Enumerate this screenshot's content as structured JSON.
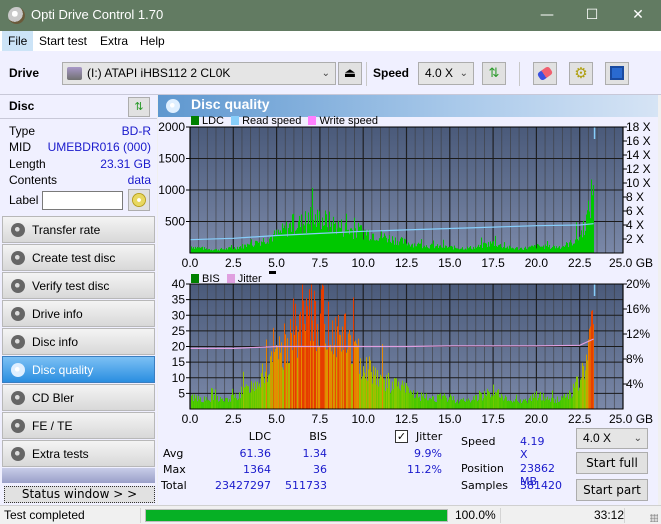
{
  "window": {
    "title": "Opti Drive Control 1.70",
    "minimize": "—",
    "maximize": "☐",
    "close": "✕"
  },
  "menu": [
    {
      "label": "File"
    },
    {
      "label": "Start test"
    },
    {
      "label": "Extra"
    },
    {
      "label": "Help"
    }
  ],
  "toolbar": {
    "drive_label": "Drive",
    "drive_value": "(I:)  ATAPI iHBS112   2 CL0K",
    "speed_label": "Speed",
    "speed_value": "4.0 X"
  },
  "disc": {
    "title": "Disc",
    "rows": [
      {
        "key": "Type",
        "value": "BD-R"
      },
      {
        "key": "MID",
        "value": "UMEBDR016 (000)"
      },
      {
        "key": "Length",
        "value": "23.31 GB"
      },
      {
        "key": "Contents",
        "value": "data"
      }
    ],
    "label_key": "Label",
    "label_value": ""
  },
  "nav": [
    {
      "label": "Transfer rate",
      "active": false
    },
    {
      "label": "Create test disc",
      "active": false
    },
    {
      "label": "Verify test disc",
      "active": false
    },
    {
      "label": "Drive info",
      "active": false
    },
    {
      "label": "Disc info",
      "active": false
    },
    {
      "label": "Disc quality",
      "active": true
    },
    {
      "label": "CD Bler",
      "active": false
    },
    {
      "label": "FE / TE",
      "active": false
    },
    {
      "label": "Extra tests",
      "active": false
    }
  ],
  "status_window_btn": "Status window > >",
  "panel": {
    "title": "Disc quality",
    "legend1": [
      "LDC",
      "Read speed",
      "Write speed"
    ],
    "legend2": [
      "BIS",
      "Jitter"
    ]
  },
  "colors": {
    "ldc": "#008000",
    "read_speed": "#87cefa",
    "write_speed": "#ff80ff",
    "bis": "#008000",
    "jitter": "#e0a0e0",
    "plot_bg_top": "#4a5a7a",
    "plot_bg_bottom": "#7a88a8",
    "accent": "#1a1acc",
    "progress": "#06b025"
  },
  "chart_data": [
    {
      "type": "area",
      "title": "LDC / Read speed",
      "xlabel": "GB",
      "xlim": [
        0,
        25
      ],
      "x_ticks": [
        "0.0",
        "2.5",
        "5.0",
        "7.5",
        "10.0",
        "12.5",
        "15.0",
        "17.5",
        "20.0",
        "22.5",
        "25.0 GB"
      ],
      "ylim_left": [
        0,
        2000
      ],
      "y_ticks_left": [
        "500",
        "1000",
        "1500",
        "2000"
      ],
      "ylim_right": [
        0,
        18
      ],
      "y_ticks_right": [
        "2 X",
        "4 X",
        "6 X",
        "8 X",
        "10 X",
        "12 X",
        "14 X",
        "16 X",
        "18 X"
      ],
      "grid": true,
      "series": [
        {
          "name": "LDC",
          "x": [
            0,
            0.5,
            1,
            1.5,
            2,
            2.5,
            3,
            3.5,
            4,
            4.5,
            5,
            5.5,
            6,
            6.5,
            7,
            7.5,
            8,
            8.5,
            9,
            9.5,
            10,
            10.5,
            11,
            11.5,
            12,
            12.5,
            13,
            13.5,
            14,
            14.5,
            15,
            15.5,
            16,
            16.5,
            17,
            17.5,
            18,
            18.5,
            19,
            19.5,
            20,
            20.5,
            21,
            21.5,
            22,
            22.5,
            23,
            23.3
          ],
          "values": [
            120,
            90,
            70,
            60,
            70,
            90,
            120,
            150,
            200,
            260,
            320,
            420,
            520,
            520,
            560,
            600,
            540,
            480,
            420,
            400,
            380,
            340,
            300,
            260,
            220,
            180,
            150,
            130,
            120,
            110,
            100,
            90,
            90,
            100,
            140,
            180,
            120,
            90,
            80,
            90,
            120,
            110,
            100,
            120,
            180,
            300,
            700,
            1300
          ]
        },
        {
          "name": "Read speed",
          "x": [
            0,
            2.5,
            5,
            7.5,
            10,
            12.5,
            15,
            17.5,
            20,
            22.5,
            23.3
          ],
          "values": [
            1.9,
            2.1,
            2.5,
            2.8,
            3.1,
            3.3,
            3.5,
            3.7,
            3.9,
            4.0,
            4.19
          ]
        }
      ]
    },
    {
      "type": "bar",
      "title": "BIS / Jitter",
      "xlabel": "GB",
      "xlim": [
        0,
        25
      ],
      "x_ticks": [
        "0.0",
        "2.5",
        "5.0",
        "7.5",
        "10.0",
        "12.5",
        "15.0",
        "17.5",
        "20.0",
        "22.5",
        "25.0 GB"
      ],
      "ylim_left": [
        0,
        40
      ],
      "y_ticks_left": [
        "5",
        "10",
        "15",
        "20",
        "25",
        "30",
        "35",
        "40"
      ],
      "ylim_right": [
        0,
        20
      ],
      "y_ticks_right": [
        "4%",
        "8%",
        "12%",
        "16%",
        "20%"
      ],
      "grid": true,
      "series": [
        {
          "name": "BIS",
          "x": [
            0,
            0.5,
            1,
            1.5,
            2,
            2.5,
            3,
            3.5,
            4,
            4.5,
            5,
            5.5,
            6,
            6.5,
            7,
            7.5,
            8,
            8.5,
            9,
            9.5,
            10,
            10.5,
            11,
            11.5,
            12,
            12.5,
            13,
            13.5,
            14,
            14.5,
            15,
            15.5,
            16,
            16.5,
            17,
            17.5,
            18,
            18.5,
            19,
            19.5,
            20,
            20.5,
            21,
            21.5,
            22,
            22.5,
            23,
            23.3
          ],
          "values": [
            4,
            4,
            3,
            4,
            3,
            4,
            6,
            8,
            11,
            14,
            17,
            23,
            29,
            28,
            32,
            33,
            29,
            27,
            25,
            20,
            16,
            14,
            11,
            9,
            8,
            7,
            5,
            4,
            4,
            4,
            4,
            3,
            3,
            4,
            5,
            7,
            4,
            3,
            3,
            3,
            5,
            4,
            3,
            4,
            6,
            10,
            20,
            36
          ]
        },
        {
          "name": "Jitter",
          "x": [
            0,
            2.5,
            5,
            7.5,
            10,
            12.5,
            15,
            17.5,
            20,
            22.5,
            23.3
          ],
          "values": [
            9.7,
            9.7,
            10.0,
            10.0,
            10.0,
            10.0,
            10.1,
            10.1,
            10.1,
            10.2,
            11.2
          ]
        }
      ]
    }
  ],
  "stats": {
    "col_ldc": "LDC",
    "col_bis": "BIS",
    "jitter_label": "Jitter",
    "jitter_checked": true,
    "rows": [
      {
        "key": "Avg",
        "ldc": "61.36",
        "bis": "1.34",
        "jitter": "9.9%"
      },
      {
        "key": "Max",
        "ldc": "1364",
        "bis": "36",
        "jitter": "11.2%"
      },
      {
        "key": "Total",
        "ldc": "23427297",
        "bis": "511733",
        "jitter": ""
      }
    ],
    "speed_label": "Speed",
    "speed_value": "4.19 X",
    "position_label": "Position",
    "position_value": "23862 MB",
    "samples_label": "Samples",
    "samples_value": "381420",
    "speed_select": "4.0 X",
    "start_full": "Start full",
    "start_part": "Start part"
  },
  "statusbar": {
    "text": "Test completed",
    "progress": 1.0,
    "percent": "100.0%",
    "time": "33:12"
  }
}
